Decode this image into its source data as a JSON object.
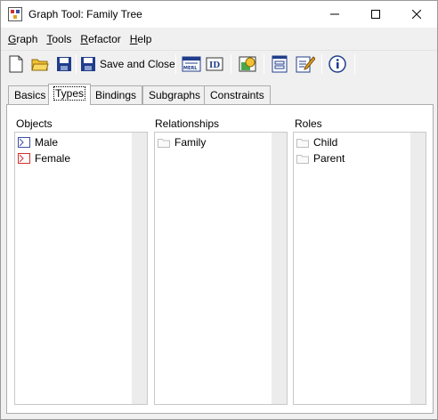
{
  "window": {
    "title": "Graph Tool: Family Tree"
  },
  "menu": [
    {
      "mnemonic": "G",
      "rest": "raph"
    },
    {
      "mnemonic": "T",
      "rest": "ools"
    },
    {
      "mnemonic": "R",
      "rest": "efactor"
    },
    {
      "mnemonic": "H",
      "rest": "elp"
    }
  ],
  "toolbar": {
    "save_close_label": "Save and Close"
  },
  "tabs": [
    "Basics",
    "Types",
    "Bindings",
    "Subgraphs",
    "Constraints"
  ],
  "active_tab": "Types",
  "columns": {
    "objects": {
      "label": "Objects",
      "items": [
        "Male",
        "Female"
      ]
    },
    "relationships": {
      "label": "Relationships",
      "items": [
        "Family"
      ]
    },
    "roles": {
      "label": "Roles",
      "items": [
        "Child",
        "Parent"
      ]
    }
  },
  "colors": {
    "male_icon": "#3a4fa3",
    "female_icon": "#d03030",
    "folder_icon": "#bdbdbd"
  }
}
